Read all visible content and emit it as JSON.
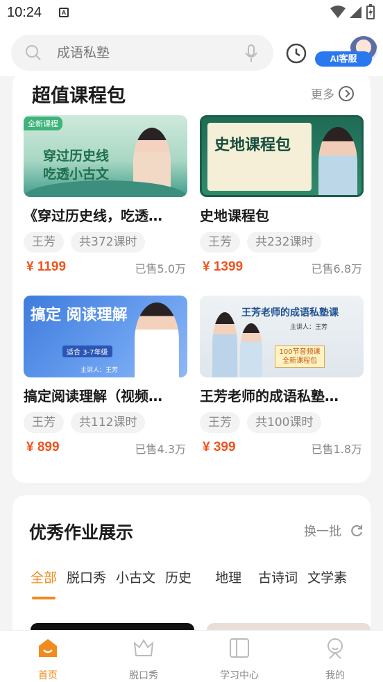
{
  "status": {
    "time": "10:24"
  },
  "search": {
    "placeholder": "成语私塾"
  },
  "ai": {
    "label": "AI客服"
  },
  "packages": {
    "title": "超值课程包",
    "more": "更多",
    "items": [
      {
        "title": "《穿过历史线，吃透…",
        "teacher": "王芳",
        "lessons": "共372课时",
        "price": "¥ 1199",
        "sold": "已售5.0万",
        "badge": "全新课程",
        "cover_text": "穿过历史线 吃透小古文"
      },
      {
        "title": "史地课程包",
        "teacher": "王芳",
        "lessons": "共232课时",
        "price": "¥ 1399",
        "sold": "已售6.8万",
        "cover_text": "史地课程包"
      },
      {
        "title": "搞定阅读理解（视频…",
        "teacher": "王芳",
        "lessons": "共112课时",
        "price": "¥ 899",
        "sold": "已售4.3万",
        "cover_text": "搞定 阅读理解",
        "cover_sub": "适合 3-7年级",
        "cover_lecturer": "主讲人：王芳"
      },
      {
        "title": "王芳老师的成语私塾…",
        "teacher": "王芳",
        "lessons": "共100课时",
        "price": "¥ 399",
        "sold": "已售1.8万",
        "cover_text": "王芳老师的成语私塾课",
        "cover_sub": "100节音频课全新课程包",
        "cover_lecturer": "主讲人：王芳"
      }
    ]
  },
  "homework": {
    "title": "优秀作业展示",
    "refresh": "换一批",
    "tabs": [
      "全部",
      "脱口秀",
      "小古文",
      "历史",
      "地理",
      "古诗词",
      "文学素"
    ]
  },
  "nav": [
    "首页",
    "脱口秀",
    "学习中心",
    "我的"
  ],
  "colors": {
    "accent": "#f28a1e",
    "price": "#f0541e",
    "ai_blue": "#2a78f0"
  }
}
